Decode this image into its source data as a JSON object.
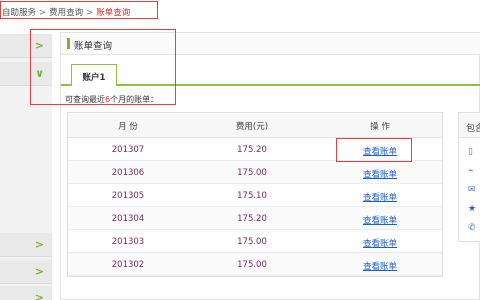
{
  "breadcrumb": {
    "items": [
      "自助服务",
      "费用查询",
      "账单查询"
    ],
    "separator": ">"
  },
  "sidebar": {
    "chevrons": [
      ">",
      "∨",
      ">",
      ">",
      ">"
    ]
  },
  "panel": {
    "title": "账单查询",
    "tab": "账户1",
    "hint_prefix": "可查询最近",
    "hint_num": "6",
    "hint_suffix": "个月的账单："
  },
  "table": {
    "headers": [
      "月 份",
      "费用(元)",
      "操 作"
    ],
    "rows": [
      {
        "month": "201307",
        "fee": "175.20",
        "action": "查看账单"
      },
      {
        "month": "201306",
        "fee": "175.00",
        "action": "查看账单"
      },
      {
        "month": "201305",
        "fee": "175.10",
        "action": "查看账单"
      },
      {
        "month": "201304",
        "fee": "175.20",
        "action": "查看账单"
      },
      {
        "month": "201303",
        "fee": "175.00",
        "action": "查看账单"
      },
      {
        "month": "201302",
        "fee": "175.00",
        "action": "查看账单"
      }
    ]
  },
  "side_panel": {
    "title": "包含",
    "icons": [
      "phone-icon",
      "network-icon",
      "message-icon",
      "star-icon",
      "call-icon"
    ],
    "icon_glyphs": [
      "▯",
      "⌁",
      "✉",
      "★",
      "✆"
    ]
  },
  "colors": {
    "accent_green": "#8cc43c",
    "highlight_red": "#e04040",
    "link_blue": "#1a5fd0"
  }
}
